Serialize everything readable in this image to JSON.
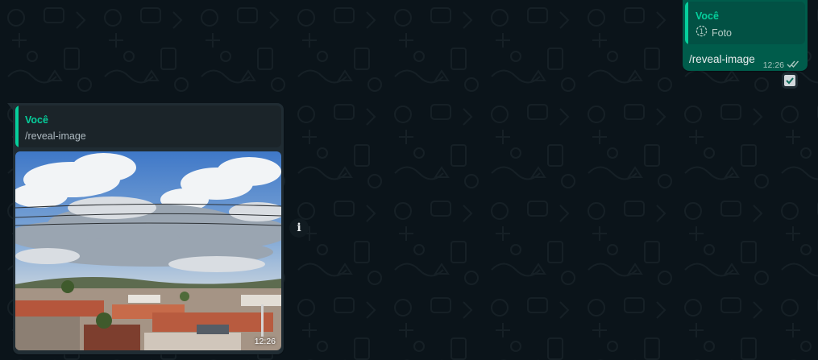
{
  "colors": {
    "background": "#0b141a",
    "outgoing_bubble": "#005c4b",
    "incoming_bubble": "#202c33",
    "accent": "#06cf9c",
    "read_ticks": "#a7c4bd"
  },
  "outgoing_message": {
    "quoted_author": "Você",
    "quoted_media_icon": "camera-icon",
    "quoted_media_label": "Foto",
    "text": "/reveal-image",
    "time": "12:26",
    "status_icon": "double-check-icon",
    "selected": true
  },
  "incoming_message": {
    "quoted_author": "Você",
    "quoted_text": "/reveal-image",
    "photo_icon": "photo-thumbnail",
    "time": "12:26"
  },
  "info_button": {
    "icon": "info-icon",
    "glyph": "i"
  }
}
